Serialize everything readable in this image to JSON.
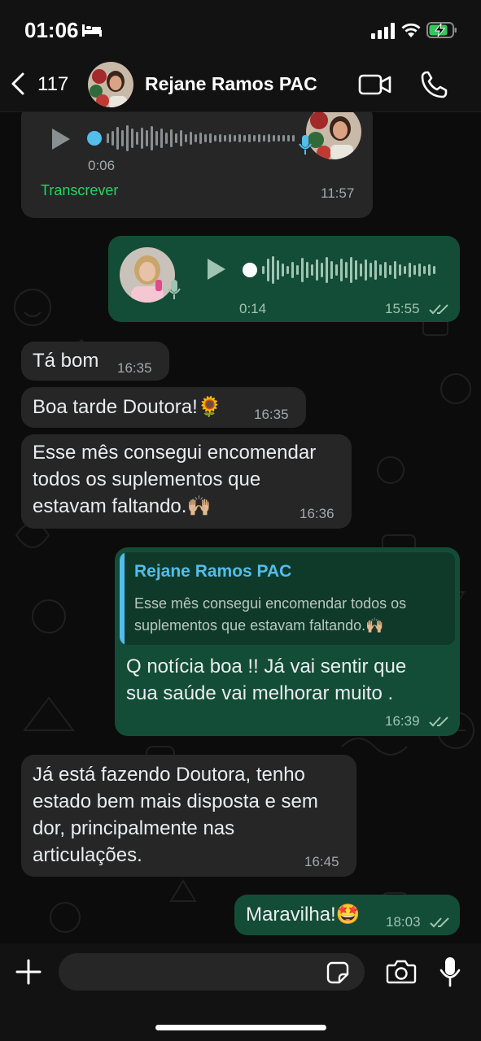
{
  "status": {
    "time": "01:06"
  },
  "header": {
    "back_count": "117",
    "contact": "Rejane Ramos PAC"
  },
  "messages": {
    "m1": {
      "duration": "0:06",
      "transcribe": "Transcrever",
      "time": "11:57"
    },
    "m2": {
      "duration": "0:14",
      "time": "15:55"
    },
    "m3": {
      "text": "Tá bom",
      "time": "16:35"
    },
    "m4": {
      "text": "Boa tarde Doutora!",
      "emoji": "🌻",
      "time": "16:35"
    },
    "m5": {
      "line1": "Esse mês consegui encomendar",
      "line2": "todos os suplementos que",
      "line3": "estavam faltando.",
      "emoji": "🙌🏼",
      "time": "16:36"
    },
    "m6": {
      "quote_author": "Rejane Ramos PAC",
      "quote_line1": "Esse mês consegui encomendar todos os",
      "quote_line2": "suplementos que estavam faltando.",
      "quote_emoji": "🙌🏼",
      "line1": "Q notícia boa !! Já vai sentir que",
      "line2": "sua saúde vai melhorar muito .",
      "time": "16:39"
    },
    "m7": {
      "line1": "Já está fazendo Doutora, tenho",
      "line2": "estado bem mais disposta e sem",
      "line3": "dor, principalmente nas",
      "line4": "articulações.",
      "time": "16:45"
    },
    "m8": {
      "text": "Maravilha!",
      "emoji": "🤩",
      "time": "18:03"
    }
  },
  "colors": {
    "incoming": "#262626",
    "outgoing": "#144d37",
    "accent_green": "#25d366",
    "quote_blue": "#53bdeb"
  },
  "icons": [
    "bed-icon",
    "signal-icon",
    "wifi-icon",
    "battery-icon",
    "back-icon",
    "video-icon",
    "phone-icon",
    "play-icon",
    "mic-icon",
    "double-check-icon",
    "plus-icon",
    "sticker-icon",
    "camera-icon"
  ]
}
